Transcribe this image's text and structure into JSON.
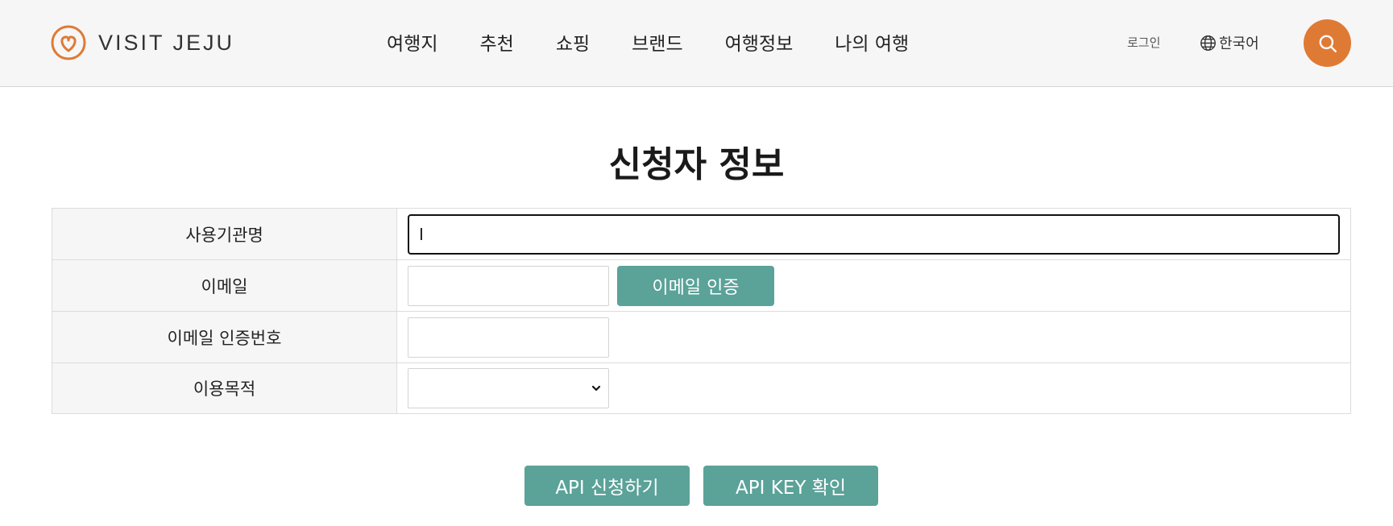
{
  "header": {
    "logo_text": "VISIT JEJU",
    "nav": [
      "여행지",
      "추천",
      "쇼핑",
      "브랜드",
      "여행정보",
      "나의 여행"
    ],
    "login": "로그인",
    "language": "한국어"
  },
  "colors": {
    "accent_orange": "#df7a35",
    "teal_button": "#5ba298",
    "label_bg": "#f6f6f6"
  },
  "page": {
    "title": "신청자 정보"
  },
  "form": {
    "org_label": "사용기관명",
    "org_value": "I",
    "email_label": "이메일",
    "email_value": "",
    "email_verify_button": "이메일 인증",
    "code_label": "이메일 인증번호",
    "code_value": "",
    "purpose_label": "이용목적",
    "purpose_selected": ""
  },
  "actions": {
    "apply_button": "API 신청하기",
    "key_button": "API KEY 확인"
  }
}
